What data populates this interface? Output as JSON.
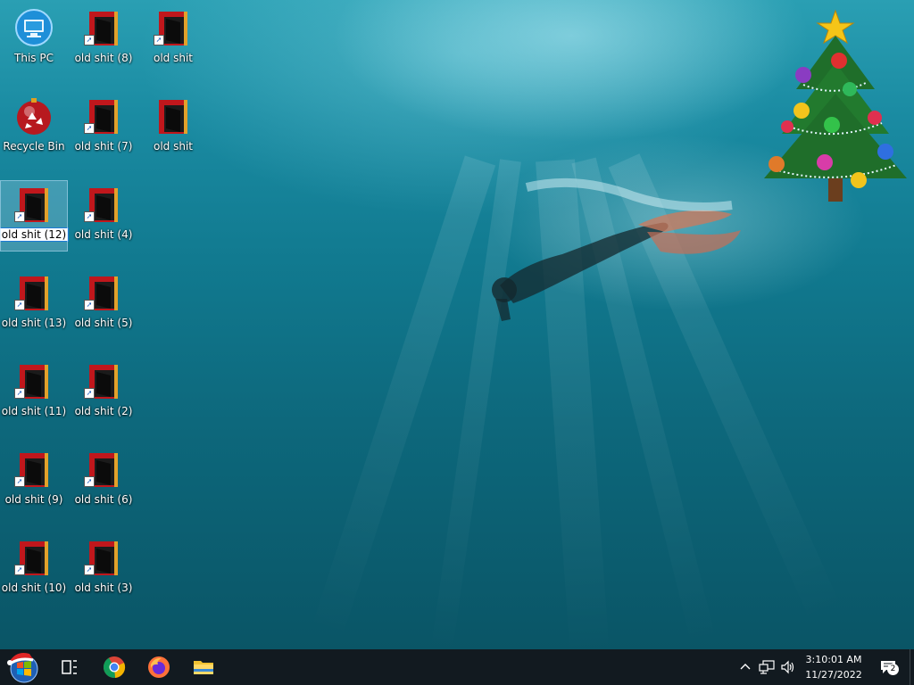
{
  "desktop": {
    "icons": [
      {
        "label": "This PC"
      },
      {
        "label": "Recycle Bin"
      },
      {
        "label": "old shit (12)"
      },
      {
        "label": "old shit (13)"
      },
      {
        "label": "old shit (11)"
      },
      {
        "label": "old shit (9)"
      },
      {
        "label": "old shit (10)"
      },
      {
        "label": "old shit (8)"
      },
      {
        "label": "old shit (7)"
      },
      {
        "label": "old shit (4)"
      },
      {
        "label": "old shit (5)"
      },
      {
        "label": "old shit (2)"
      },
      {
        "label": "old shit (6)"
      },
      {
        "label": "old shit (3)"
      },
      {
        "label": "old shit"
      },
      {
        "label": "old shit"
      }
    ],
    "selected_icon": "old shit (12)",
    "widget_icon": "christmas-tree-icon"
  },
  "taskbar": {
    "start_icon": "start-orb-icon",
    "pinned": [
      {
        "icon": "task-view-icon"
      },
      {
        "icon": "chrome-icon"
      },
      {
        "icon": "firefox-icon"
      },
      {
        "icon": "file-explorer-icon"
      }
    ],
    "tray": {
      "time": "3:10:01 AM",
      "date": "11/27/2022",
      "notification_count": "2"
    }
  },
  "colors": {
    "taskbar_bg": "#121a20",
    "folder_red": "#c0171c",
    "water_top": "#2a9fb3",
    "water_bottom": "#0a5566"
  }
}
